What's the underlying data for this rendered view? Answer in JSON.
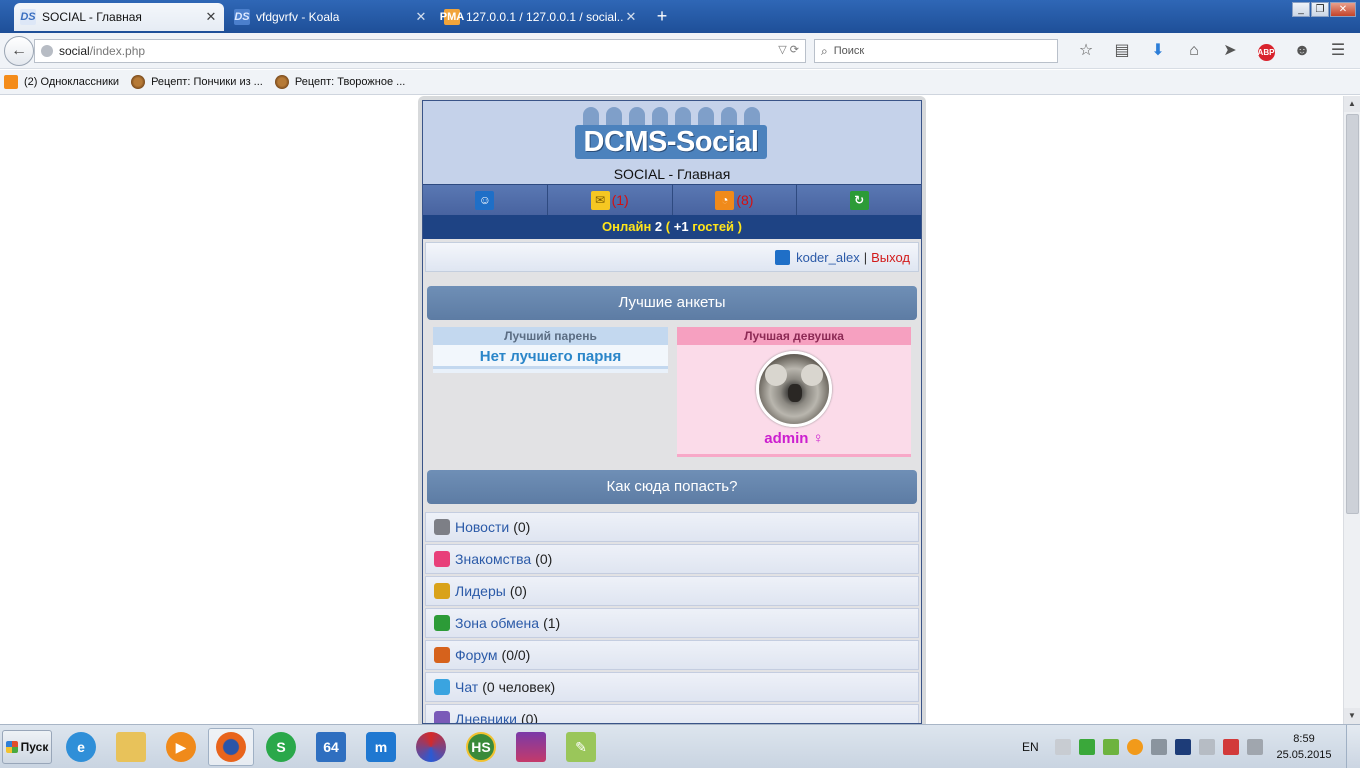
{
  "browser": {
    "tabs": [
      {
        "title": "SOCIAL - Главная",
        "active": true,
        "favicon": "DS"
      },
      {
        "title": "vfdgvrfv - Koala",
        "active": false,
        "favicon": "DS"
      },
      {
        "title": "127.0.0.1 / 127.0.0.1 / social...",
        "active": false,
        "favicon": "PMA"
      }
    ],
    "url_host": "social",
    "url_path": "/index.php",
    "search_placeholder": "Поиск",
    "bookmarks": [
      {
        "label": "(2) Одноклассники"
      },
      {
        "label": "Рецепт: Пончики из ..."
      },
      {
        "label": "Рецепт: Творожное ..."
      }
    ]
  },
  "site": {
    "logo_text": "DCMS-Social",
    "title": "SOCIAL - Главная",
    "iconbar": {
      "mail_count": "(1)",
      "rss_count": "(8)"
    },
    "online": {
      "label": "Онлайн",
      "count": "2",
      "guests_open": "(",
      "guests_count": "+1",
      "guests_label": "гостей )"
    },
    "user": {
      "name": "koder_alex",
      "separator": "|",
      "logout": "Выход"
    },
    "best_section": "Лучшие анкеты",
    "best_boy": {
      "header": "Лучший парень",
      "text": "Нет лучшего парня"
    },
    "best_girl": {
      "header": "Лучшая девушка",
      "name": "admin",
      "gender_symbol": "♀"
    },
    "how_section": "Как сюда попасть?",
    "menu": [
      {
        "label": "Новости",
        "count": "(0)",
        "color": "#7d7f86"
      },
      {
        "label": "Знакомства",
        "count": "(0)",
        "color": "#e8407a"
      },
      {
        "label": "Лидеры",
        "count": "(0)",
        "color": "#d9a21a"
      },
      {
        "label": "Зона обмена",
        "count": "(1)",
        "color": "#2c9b37"
      },
      {
        "label": "Форум",
        "count": "(0/0)",
        "color": "#d6621c"
      },
      {
        "label": "Чат",
        "count": "(0 человек)",
        "color": "#3aa4e0"
      },
      {
        "label": "Дневники",
        "count": "(0)",
        "color": "#7a5ab8"
      }
    ]
  },
  "taskbar": {
    "start_label": "Пуск",
    "lang": "EN",
    "time": "8:59",
    "date": "25.05.2015"
  }
}
